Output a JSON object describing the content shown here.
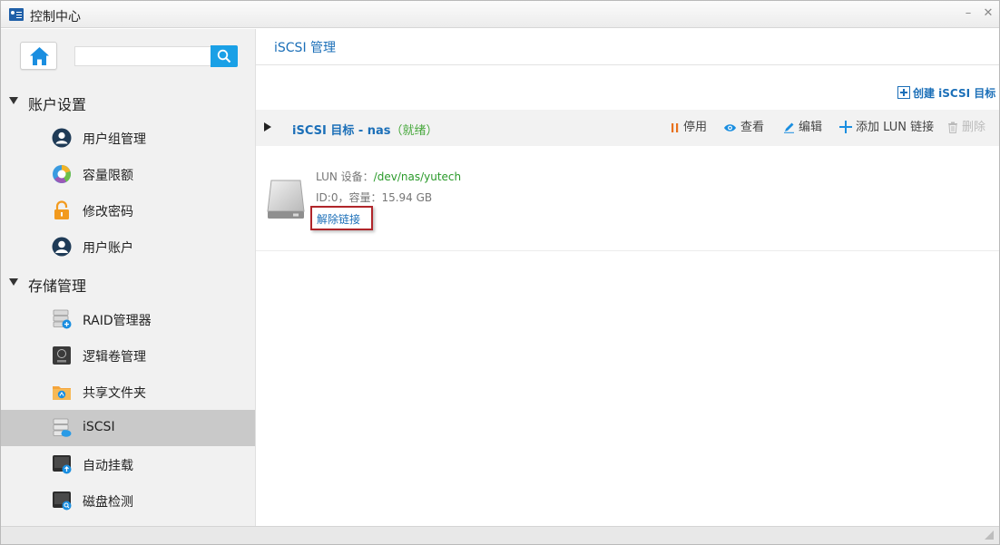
{
  "window": {
    "title": "控制中心",
    "minimize_glyph": "–",
    "close_glyph": "✕"
  },
  "sidebar": {
    "search": {
      "value": "",
      "placeholder": ""
    },
    "sections": [
      {
        "label": "账户设置",
        "items": [
          {
            "label": "用户组管理",
            "icon": "user-group-icon"
          },
          {
            "label": "容量限额",
            "icon": "quota-pie-icon"
          },
          {
            "label": "修改密码",
            "icon": "lock-icon"
          },
          {
            "label": "用户账户",
            "icon": "user-account-icon"
          }
        ]
      },
      {
        "label": "存储管理",
        "items": [
          {
            "label": "RAID管理器",
            "icon": "raid-icon"
          },
          {
            "label": "逻辑卷管理",
            "icon": "lvm-icon"
          },
          {
            "label": "共享文件夹",
            "icon": "shared-folder-icon"
          },
          {
            "label": "iSCSI",
            "icon": "iscsi-icon",
            "active": true
          },
          {
            "label": "自动挂载",
            "icon": "automount-icon"
          },
          {
            "label": "磁盘检测",
            "icon": "disk-check-icon"
          }
        ]
      }
    ]
  },
  "main": {
    "title": "iSCSI 管理",
    "create_target_label": "创建 iSCSI 目标",
    "target": {
      "name": "iSCSI 目标 - nas",
      "status": "（就绪）",
      "actions": {
        "stop": "停用",
        "view": "查看",
        "edit": "编辑",
        "add_lun": "添加 LUN 链接",
        "delete": "删除"
      }
    },
    "lun": {
      "device_label": "LUN 设备：",
      "device_path": "/dev/nas/yutech",
      "info": "ID:0，容量：15.94 GB",
      "unlink_label": "解除链接"
    }
  },
  "colors": {
    "link_blue": "#1b6fb8",
    "status_green": "#47a83c",
    "search_blue": "#1aa0e6",
    "highlight_red": "#b0252a",
    "active_row": "#c9c9c9"
  }
}
